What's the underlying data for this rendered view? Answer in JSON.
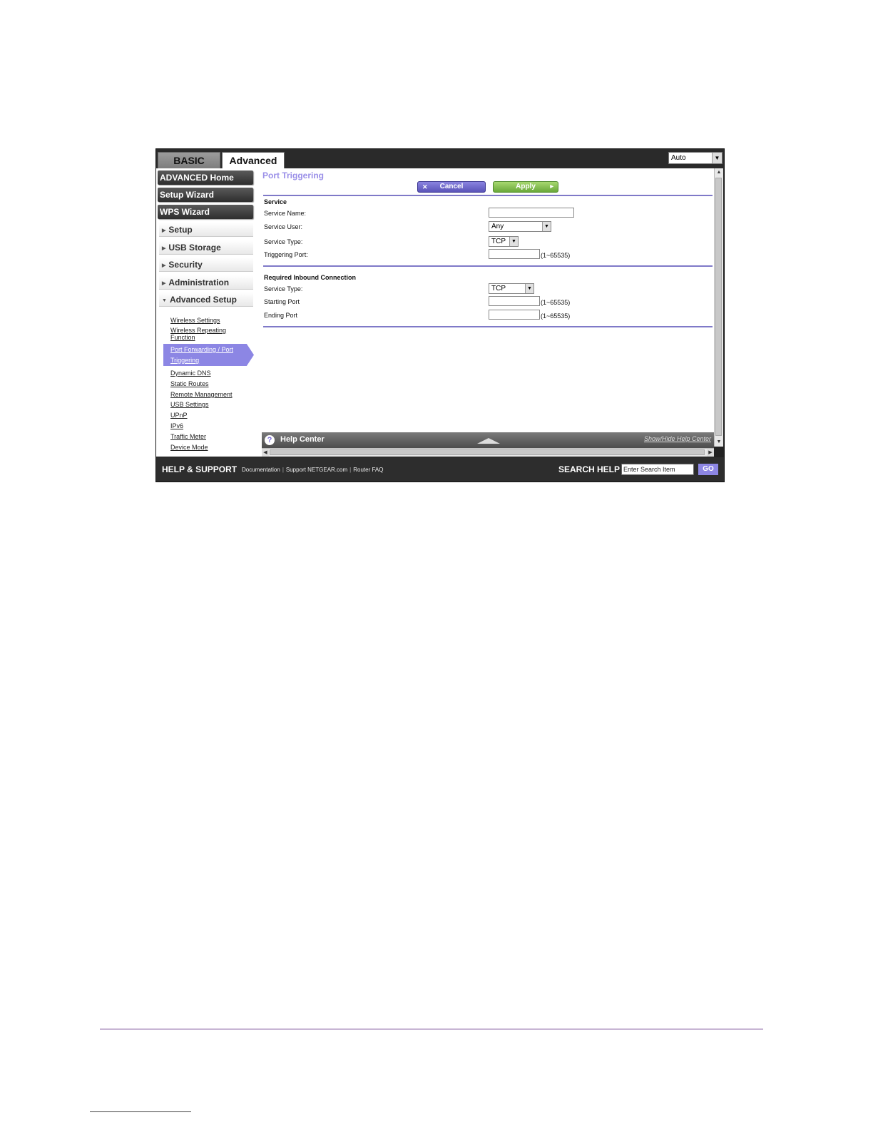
{
  "tabs": {
    "basic": "BASIC",
    "advanced": "Advanced"
  },
  "language": {
    "selected": "Auto"
  },
  "nav": {
    "advanced_home": "ADVANCED Home",
    "setup_wizard": "Setup Wizard",
    "wps_wizard": "WPS Wizard"
  },
  "menus": {
    "setup": "Setup",
    "usb_storage": "USB Storage",
    "security": "Security",
    "administration": "Administration",
    "advanced_setup": "Advanced Setup"
  },
  "submenu": {
    "wireless_settings": "Wireless Settings",
    "wireless_repeating_1": "Wireless Repeating",
    "wireless_repeating_2": "Function",
    "port_forwarding_1": "Port Forwarding / Port",
    "port_forwarding_2": "Triggering",
    "dynamic_dns": "Dynamic DNS",
    "static_routes": "Static Routes",
    "remote_management": "Remote Management",
    "usb_settings": "USB Settings",
    "upnp": "UPnP",
    "ipv6": "IPv6",
    "traffic_meter": "Traffic Meter",
    "device_mode": "Device Mode"
  },
  "page": {
    "title": "Port Triggering",
    "cancel": "Cancel",
    "apply": "Apply"
  },
  "service": {
    "heading": "Service",
    "name_label": "Service Name:",
    "name_value": "",
    "user_label": "Service User:",
    "user_value": "Any",
    "type_label": "Service Type:",
    "type_value": "TCP",
    "trigger_label": "Triggering Port:",
    "trigger_value": "",
    "trigger_range": "(1~65535)"
  },
  "inbound": {
    "heading": "Required Inbound Connection",
    "type_label": "Service Type:",
    "type_value": "TCP",
    "start_label": "Starting Port",
    "start_value": "",
    "start_range": "(1~65535)",
    "end_label": "Ending Port",
    "end_value": "",
    "end_range": "(1~65535)"
  },
  "help": {
    "title": "Help Center",
    "toggle": "Show/Hide Help Center"
  },
  "footer": {
    "title": "HELP & SUPPORT",
    "links": [
      "Documentation",
      "Support NETGEAR.com",
      "Router FAQ"
    ],
    "search_label": "SEARCH HELP",
    "search_placeholder": "Enter Search Item",
    "go": "GO"
  }
}
